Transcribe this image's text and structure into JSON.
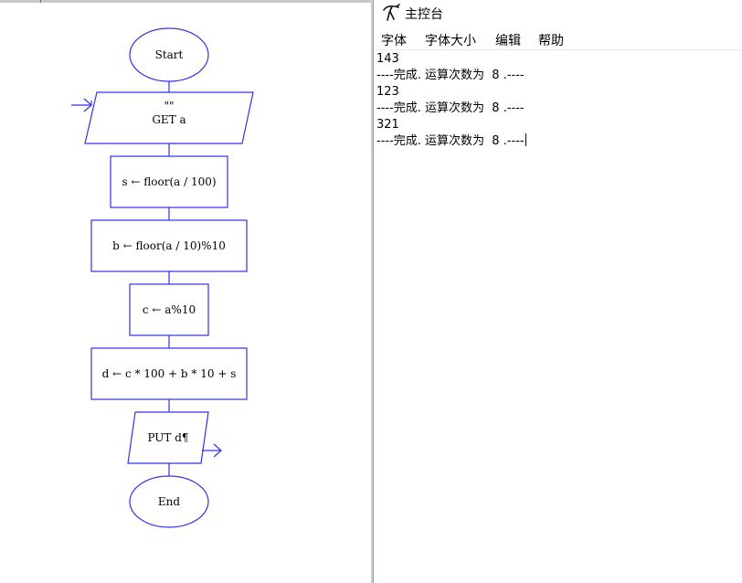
{
  "flowchart": {
    "start": "Start",
    "input_prompt": "\"\"",
    "input_statement": "GET a",
    "step_s": "s ← floor(a / 100)",
    "step_b": "b ← floor(a / 10)%10",
    "step_c": "c ← a%10",
    "step_d": "d ← c * 100 + b * 10 + s",
    "output": "PUT d¶",
    "end": "End"
  },
  "console": {
    "title": "主控台",
    "menu": [
      "字体",
      "字体大小",
      "编辑",
      "帮助"
    ],
    "lines": [
      "143",
      "----完成. 运算次数为  8 .----",
      "123",
      "----完成. 运算次数为  8 .----",
      "321",
      "----完成. 运算次数为  8 .----"
    ]
  },
  "colors": {
    "flow_stroke": "#3333e6",
    "divider": "#c9ccd2"
  },
  "icons": {
    "app": "dinosaur-icon",
    "input_arrow": "arrow-right-icon",
    "output_arrow": "arrow-right-icon"
  }
}
